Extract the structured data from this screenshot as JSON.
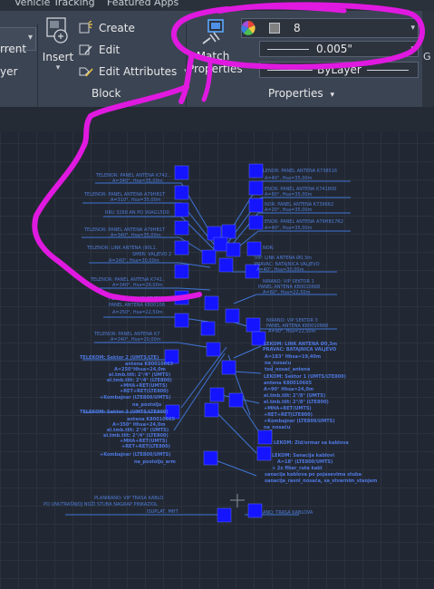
{
  "tabs": [
    "Vehicle Tracking",
    "Featured Apps"
  ],
  "left_clip": {
    "line1": "rrent",
    "line2": "yer"
  },
  "block_panel": {
    "title": "Block",
    "insert_label": "Insert",
    "create_label": "Create",
    "edit_label": "Edit",
    "edit_attributes_label": "Edit Attributes"
  },
  "properties_panel": {
    "title": "Properties",
    "match_properties_line1": "Match",
    "match_properties_line2": "Properties",
    "color_value": "8",
    "lineweight_value": "0.005\"",
    "linetype_value": "ByLayer"
  },
  "drawing": {
    "left_labels": [
      "TELENOR: PANEL ANTENA K742...",
      "A=340°, Hsa=35,00m",
      "TELENOR: PANEL ANTENA A79HB1T",
      "A=310°, Hsa=35,00m",
      "RRU 3268 AN PO 90AG15D0",
      "TELENOR: PANEL ANTENA A79HB1T",
      "A=340°, Hsa=35,00m",
      "TELENOR: LINK ANTENA (90L1.",
      "SMER: VALJEVO 2",
      "A=240°, Hsa=30,00m",
      "TELENOR: PANEL ANTENA K742..",
      "A=340°, Hsa=29,00m",
      "PLANIRANO: VIP SEKTOR",
      "PANEL ANTENA K800108",
      "A=250°, Hsa=22,50m",
      "TELENOR: PANEL ANTENA K7",
      "A=240°, Hsa=20,00m"
    ],
    "right_labels": [
      "LENOR: PANEL ANTENA K738516",
      "A=40°, Hsa=35,00m",
      "ENOR: PANEL ANTENA K741800",
      "A=60°, Hsa=35,00m",
      "NOR: PANEL ANTENA K739662",
      "A=20°, Hsa=35,00m",
      "ENOR: PANEL ANTENA A79HB17R2",
      "A=40°, Hsa=35,00m",
      "NOR:",
      "VIP: LINK ANTENA Ø0,3m",
      "PRAVAC: BATAJNICA VALJEVO",
      "A=40°, Hsa=30,00m",
      "NIRANO: VIP SEKTOR 1",
      "PANEL ANTENA K80010668",
      "A=60°, Hsa=22,50m",
      "NIRANO: VIP SEKTOR 3",
      "PANEL ANTENA K80010668",
      "A=90°, Hsa=22,50m"
    ],
    "telekom_left": [
      "TELEKOM: Sektor 2 (UMTS/LTE)",
      "antena K80010663",
      "A=250°Hhsa=24,0m",
      "el.tmb.tilt: 2°/4° (UMTS)",
      "el.tmb.tilt: 2°/4° (LTE800)",
      "+MHA+RET(UMTS)",
      "+RET+RET(LTE800)",
      "+Kombajner (LTE800/UMTS)",
      "na_postolju",
      "TELEKOM: Sektor 3 (UMTS/LTE800)",
      "antena K80010665",
      "A=350° Hhsa=24,0m",
      "el.tmb.tilt: 2°/4° (UMTS)",
      "el.tmb.tilt: 2°/4° (LTE800)",
      "+MHA+RET(UMTS)",
      "+RET+RET(LTE800)",
      "+Kombajner (LTE800/UMTS)",
      "na_postolju_arm"
    ],
    "telekom_right": [
      "LEKOM: LINK ANTENA Ø0,3m",
      "PRAVAC: BATAJNICA VALJEVO",
      "A=183° Hhsa=19,40m",
      "na_nosaču",
      "tod_nosač_antene",
      "LEKOM: Sektor 1 (UMTS/LTE800)",
      "antena K80010665",
      "A=90° Hhsa=24,0m",
      "el.tmb.tilt: 2°/8° (UMTS)",
      "el.tmb.tilt: 2°/8° (LTE800)",
      "+MHA+RET(UMTS)",
      "+RET+RET(LTE800)",
      "+Kombajner (LTE800/UMTS)",
      "na_nosaču",
      "LEKOM: Zid/ormar sa kablova",
      "LEKOM: Sanacija kablovi",
      "A=18° (LTE800/UMTS)",
      "+ 2x fiber_ruta kabl",
      "sanacija kablova po pojasevima stuba",
      "sanacija_rasni_nosača, sa_stvarnim_stanjem"
    ],
    "bottom_left": [
      "PLANIRANO: VIP TRASA KABLO",
      "PO UNUTRAŠNJOJ NOŽI STUBA NAGRAP PINKAZIOL",
      "ISUPLAT, MHT"
    ],
    "bottom_right": "ANO: TRASA KABLOVA"
  },
  "colors": {
    "ribbon_bg": "#3b4453",
    "canvas_bg": "#222833",
    "block_fill": "#1414ff",
    "line_color": "#3f74d6",
    "highlighter": "#e019e0"
  }
}
